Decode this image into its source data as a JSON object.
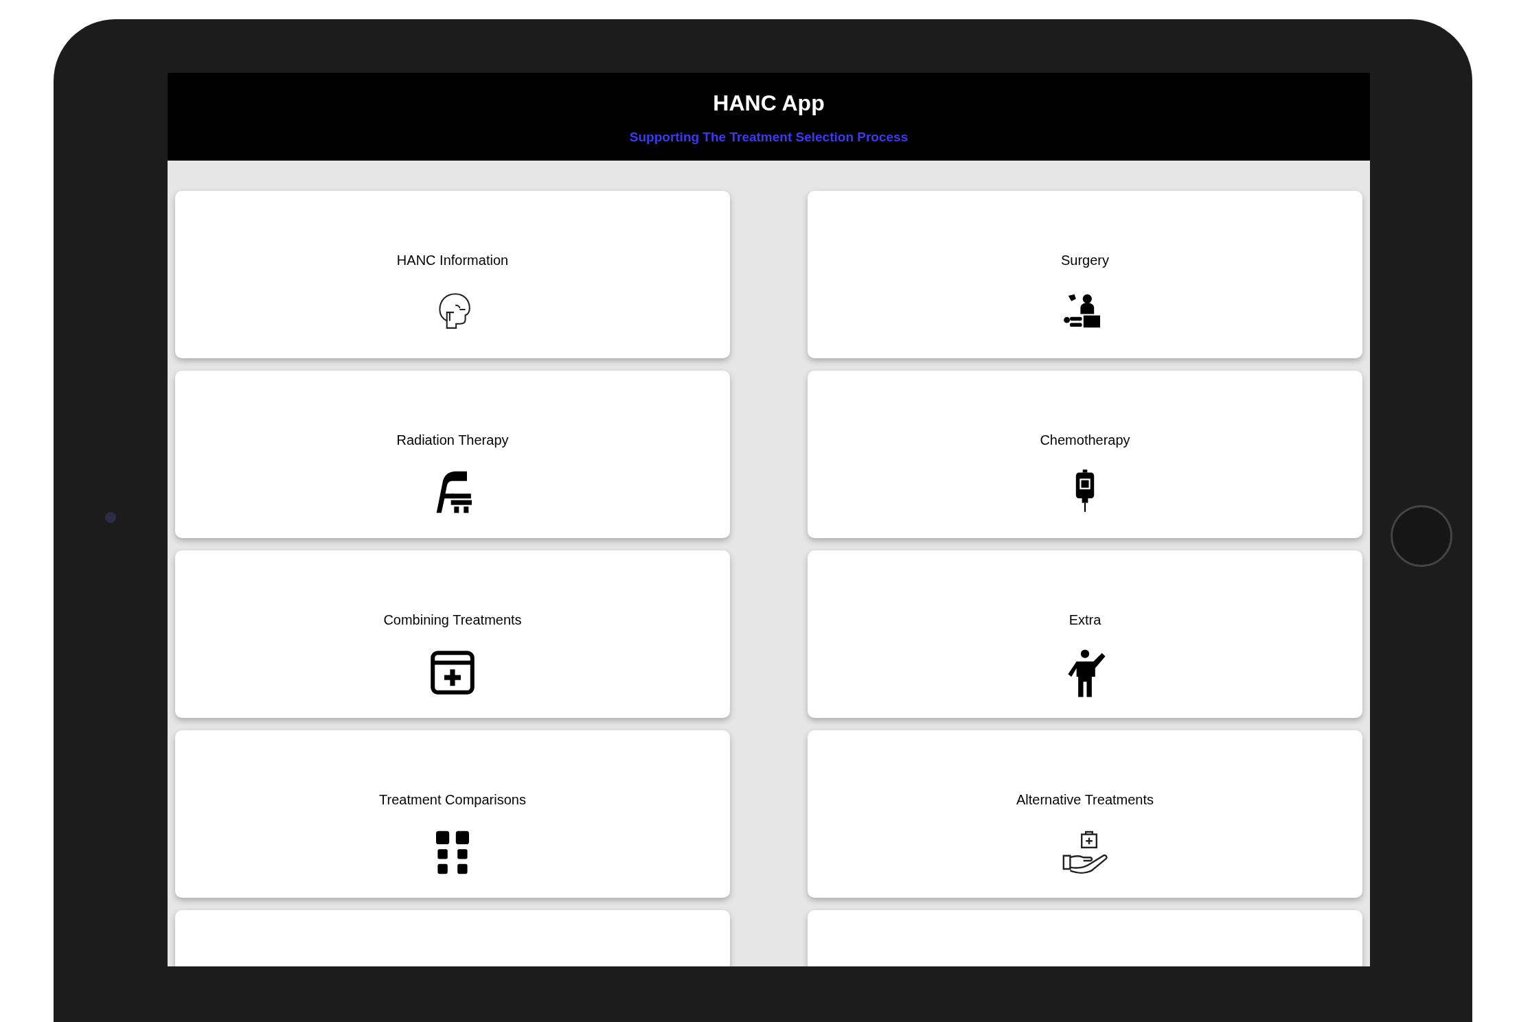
{
  "header": {
    "title": "HANC App",
    "subtitle": "Supporting The Treatment Selection Process"
  },
  "cards": [
    {
      "title": "HANC Information"
    },
    {
      "title": "Surgery"
    },
    {
      "title": "Radiation Therapy"
    },
    {
      "title": "Chemotherapy"
    },
    {
      "title": "Combining Treatments"
    },
    {
      "title": "Extra"
    },
    {
      "title": "Treatment Comparisons"
    },
    {
      "title": "Alternative Treatments"
    }
  ]
}
